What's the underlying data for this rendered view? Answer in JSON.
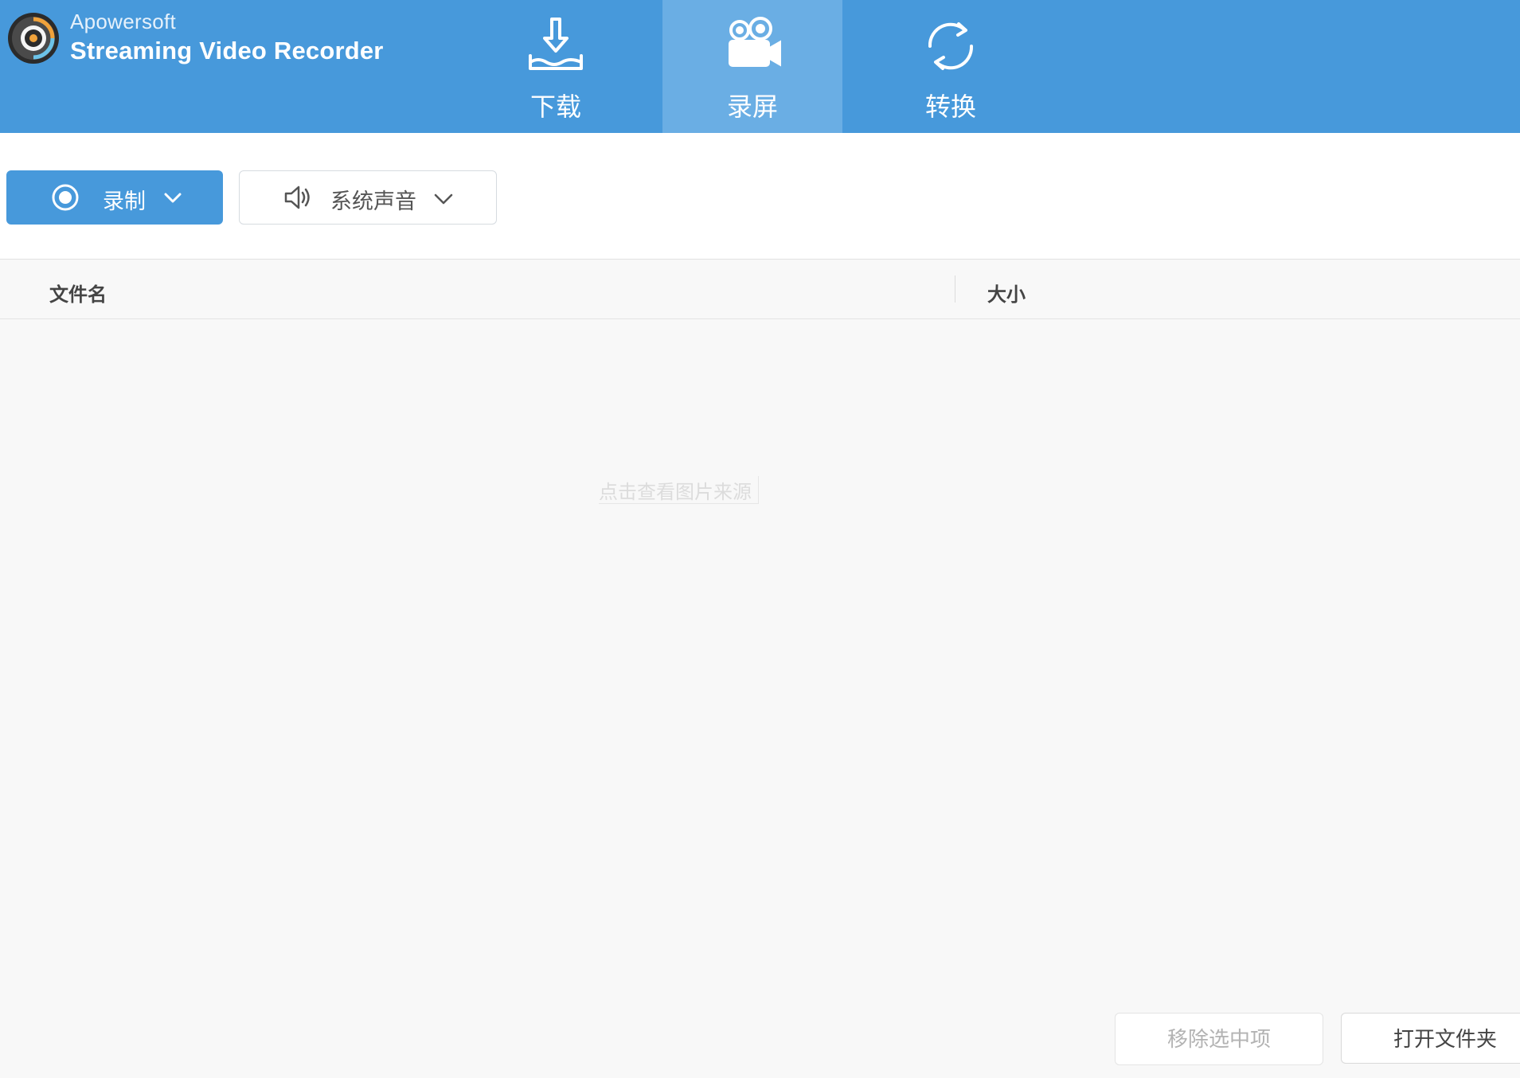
{
  "app": {
    "company": "Apowersoft",
    "product": "Streaming Video Recorder",
    "logo_icon": "camera-lens-logo"
  },
  "nav": {
    "tabs": [
      {
        "label": "下载",
        "icon": "download-tray-icon",
        "active": false
      },
      {
        "label": "录屏",
        "icon": "video-camera-icon",
        "active": true
      },
      {
        "label": "转换",
        "icon": "convert-arrows-icon",
        "active": false
      }
    ]
  },
  "toolbar": {
    "record_label": "录制",
    "audio_label": "系统声音"
  },
  "table": {
    "columns": [
      "文件名",
      "大小"
    ],
    "rows": [],
    "watermark": "点击查看图片来源"
  },
  "footer": {
    "remove_label": "移除选中项",
    "open_folder_label": "打开文件夹"
  },
  "colors": {
    "header_bg": "#4799db",
    "active_tab_bg": "#6aaee4",
    "primary_button": "#4799db",
    "list_bg": "#f8f8f8"
  }
}
